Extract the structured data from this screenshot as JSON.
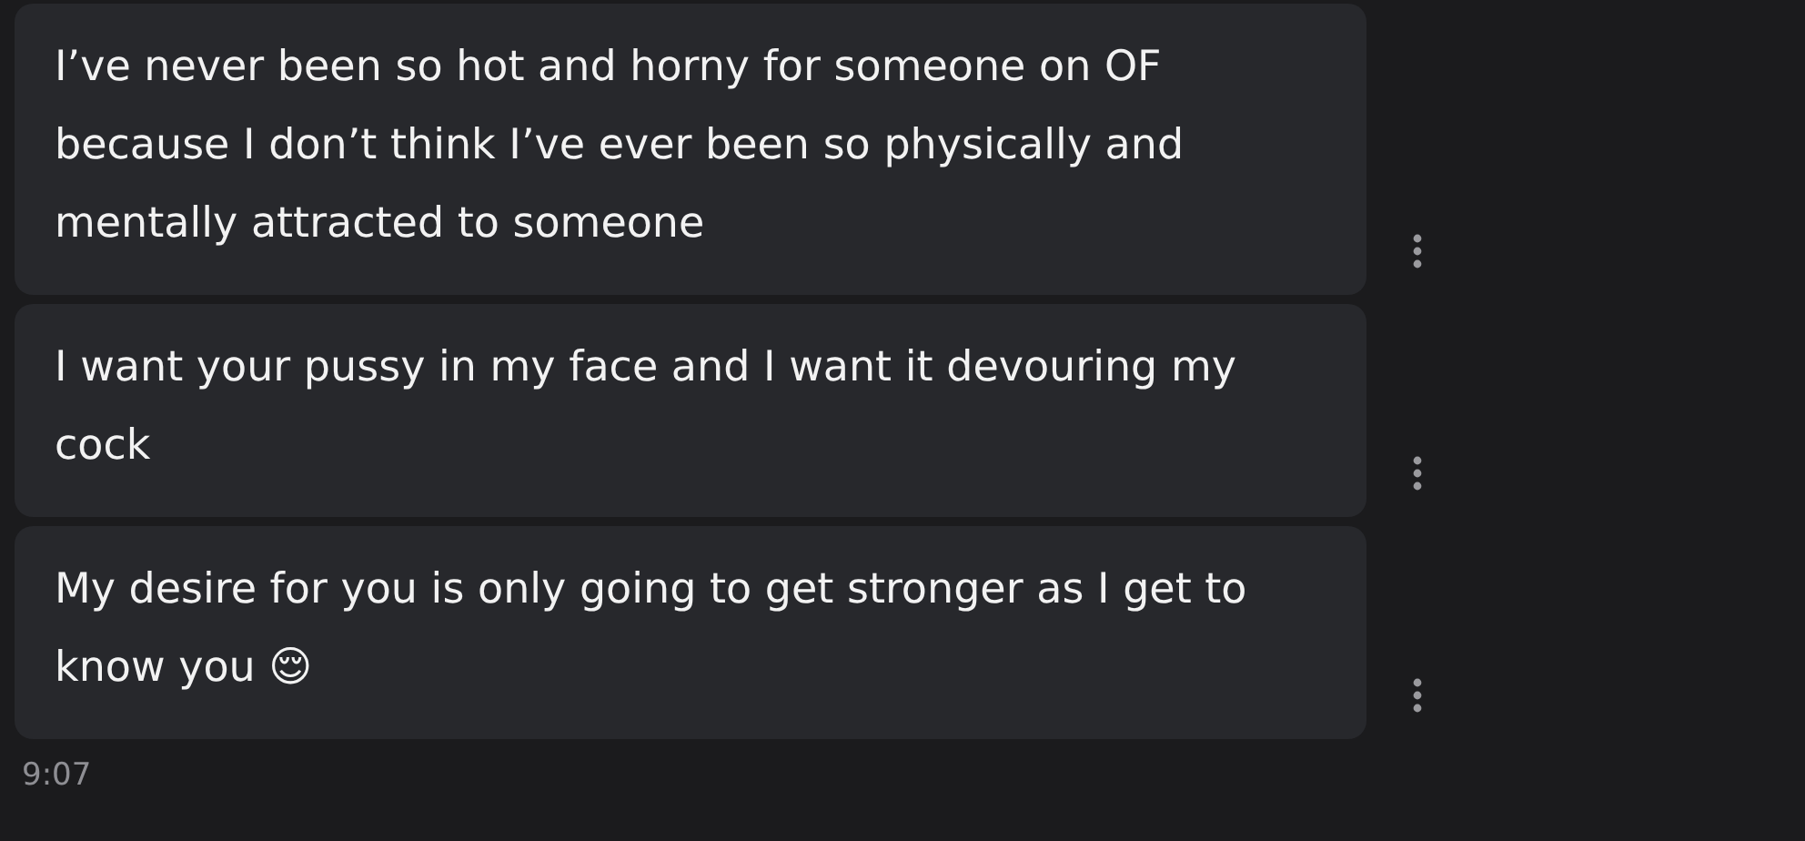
{
  "messages": [
    {
      "text": "I’ve never been so hot and horny for someone on OF because I don’t think I’ve ever been so physically and mentally attracted to someone"
    },
    {
      "text": "I want your pussy in my face and I want it devouring my cock"
    },
    {
      "text": "My desire for you is only going to get stronger as I get to know you 😌"
    }
  ],
  "time": "9:07"
}
